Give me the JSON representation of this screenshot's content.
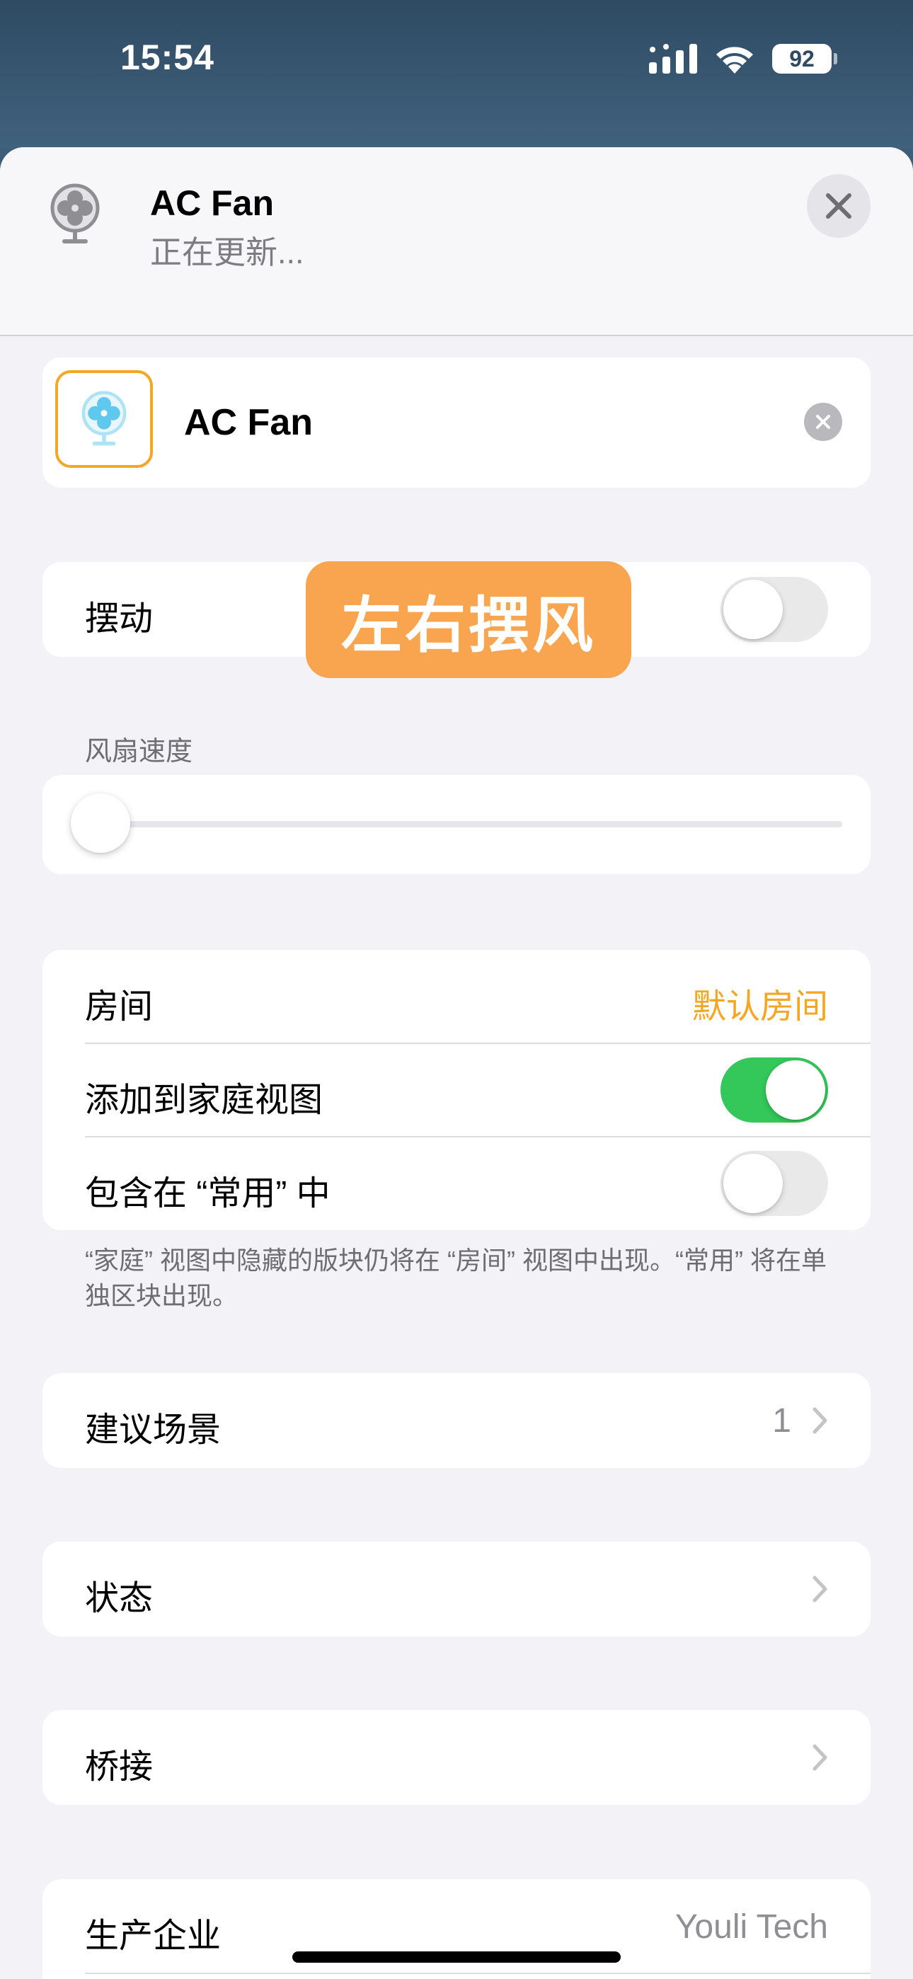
{
  "status_bar": {
    "time": "15:54",
    "battery": "92"
  },
  "header": {
    "title": "AC Fan",
    "subtitle": "正在更新..."
  },
  "name_card": {
    "name": "AC Fan"
  },
  "swing": {
    "label": "摆动",
    "on": false
  },
  "overlay": {
    "text": "左右摆风"
  },
  "fan_speed": {
    "label": "风扇速度",
    "value": 0
  },
  "settings": {
    "room_label": "房间",
    "room_value": "默认房间",
    "home_view_label": "添加到家庭视图",
    "home_view_on": true,
    "favorites_label": "包含在 “常用” 中",
    "favorites_on": false,
    "footnote": "“家庭” 视图中隐藏的版块仍将在 “房间” 视图中出现。“常用” 将在单独区块出现。"
  },
  "scenes": {
    "label": "建议场景",
    "count": "1"
  },
  "status": {
    "label": "状态"
  },
  "bridge": {
    "label": "桥接"
  },
  "manufacturer": {
    "label": "生产企业",
    "value": "Youli Tech"
  },
  "colors": {
    "accent": "#f5a623",
    "toggle_on": "#34c759",
    "badge": "#f9a44e"
  }
}
